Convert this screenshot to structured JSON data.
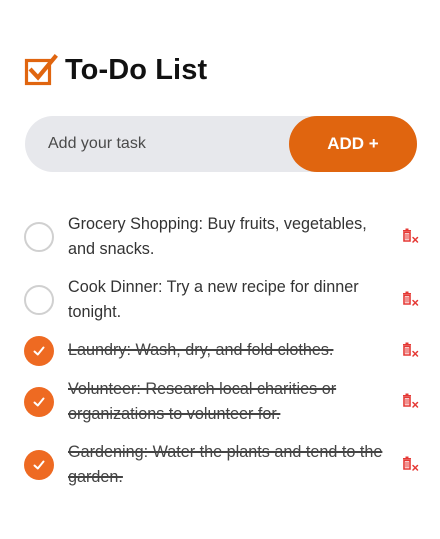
{
  "header": {
    "title": "To-Do List",
    "icon": "checkbox-checked-icon",
    "accent_color": "#e0650f"
  },
  "input": {
    "placeholder": "Add your task",
    "value": ""
  },
  "add_button": {
    "label": "ADD +"
  },
  "tasks": [
    {
      "text": "Grocery Shopping: Buy fruits, vegetables, and snacks.",
      "done": false
    },
    {
      "text": "Cook Dinner: Try a new recipe for dinner tonight.",
      "done": false
    },
    {
      "text": "Laundry: Wash, dry, and fold clothes.",
      "done": true
    },
    {
      "text": "Volunteer: Research local charities or organizations to volunteer for.",
      "done": true
    },
    {
      "text": "Gardening: Water the plants and tend to the garden.",
      "done": true
    }
  ],
  "icons": {
    "check": "check-icon",
    "delete": "trash-icon"
  },
  "colors": {
    "done_fill": "#ee6a22",
    "delete_icon": "#e53935",
    "input_bg": "#e7e8ec"
  }
}
